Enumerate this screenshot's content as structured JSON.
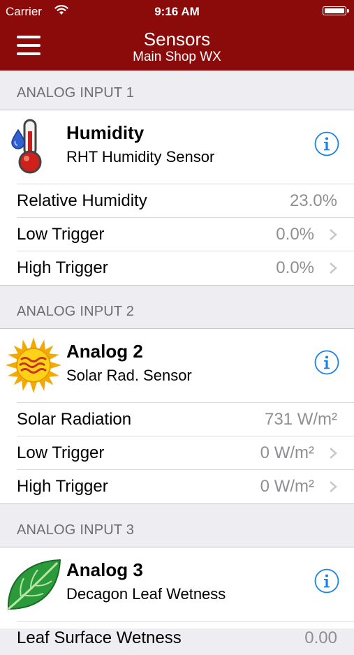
{
  "status_bar": {
    "carrier": "Carrier",
    "time": "9:16 AM"
  },
  "nav": {
    "title": "Sensors",
    "subtitle": "Main Shop WX"
  },
  "sections": [
    {
      "header": "ANALOG INPUT 1",
      "sensor": {
        "name": "Humidity",
        "type": "RHT Humidity Sensor",
        "icon": "thermometer-drop-icon"
      },
      "rows": [
        {
          "label": "Relative Humidity",
          "value": "23.0%"
        },
        {
          "label": "Low Trigger",
          "value": "0.0%"
        },
        {
          "label": "High Trigger",
          "value": "0.0%"
        }
      ]
    },
    {
      "header": "ANALOG INPUT 2",
      "sensor": {
        "name": "Analog 2",
        "type": "Solar Rad. Sensor",
        "icon": "sun-icon"
      },
      "rows": [
        {
          "label": "Solar Radiation",
          "value": "731 W/m²"
        },
        {
          "label": "Low Trigger",
          "value": "0 W/m²"
        },
        {
          "label": "High Trigger",
          "value": "0 W/m²"
        }
      ]
    },
    {
      "header": "ANALOG INPUT 3",
      "sensor": {
        "name": "Analog 3",
        "type": "Decagon Leaf Wetness",
        "icon": "leaf-icon"
      },
      "rows": [
        {
          "label": "Leaf Surface Wetness",
          "value": "0.00"
        }
      ]
    }
  ],
  "colors": {
    "nav_bar": "#8b0a0a",
    "info_blue": "#1a82e6",
    "secondary_text": "#8e8e93"
  }
}
